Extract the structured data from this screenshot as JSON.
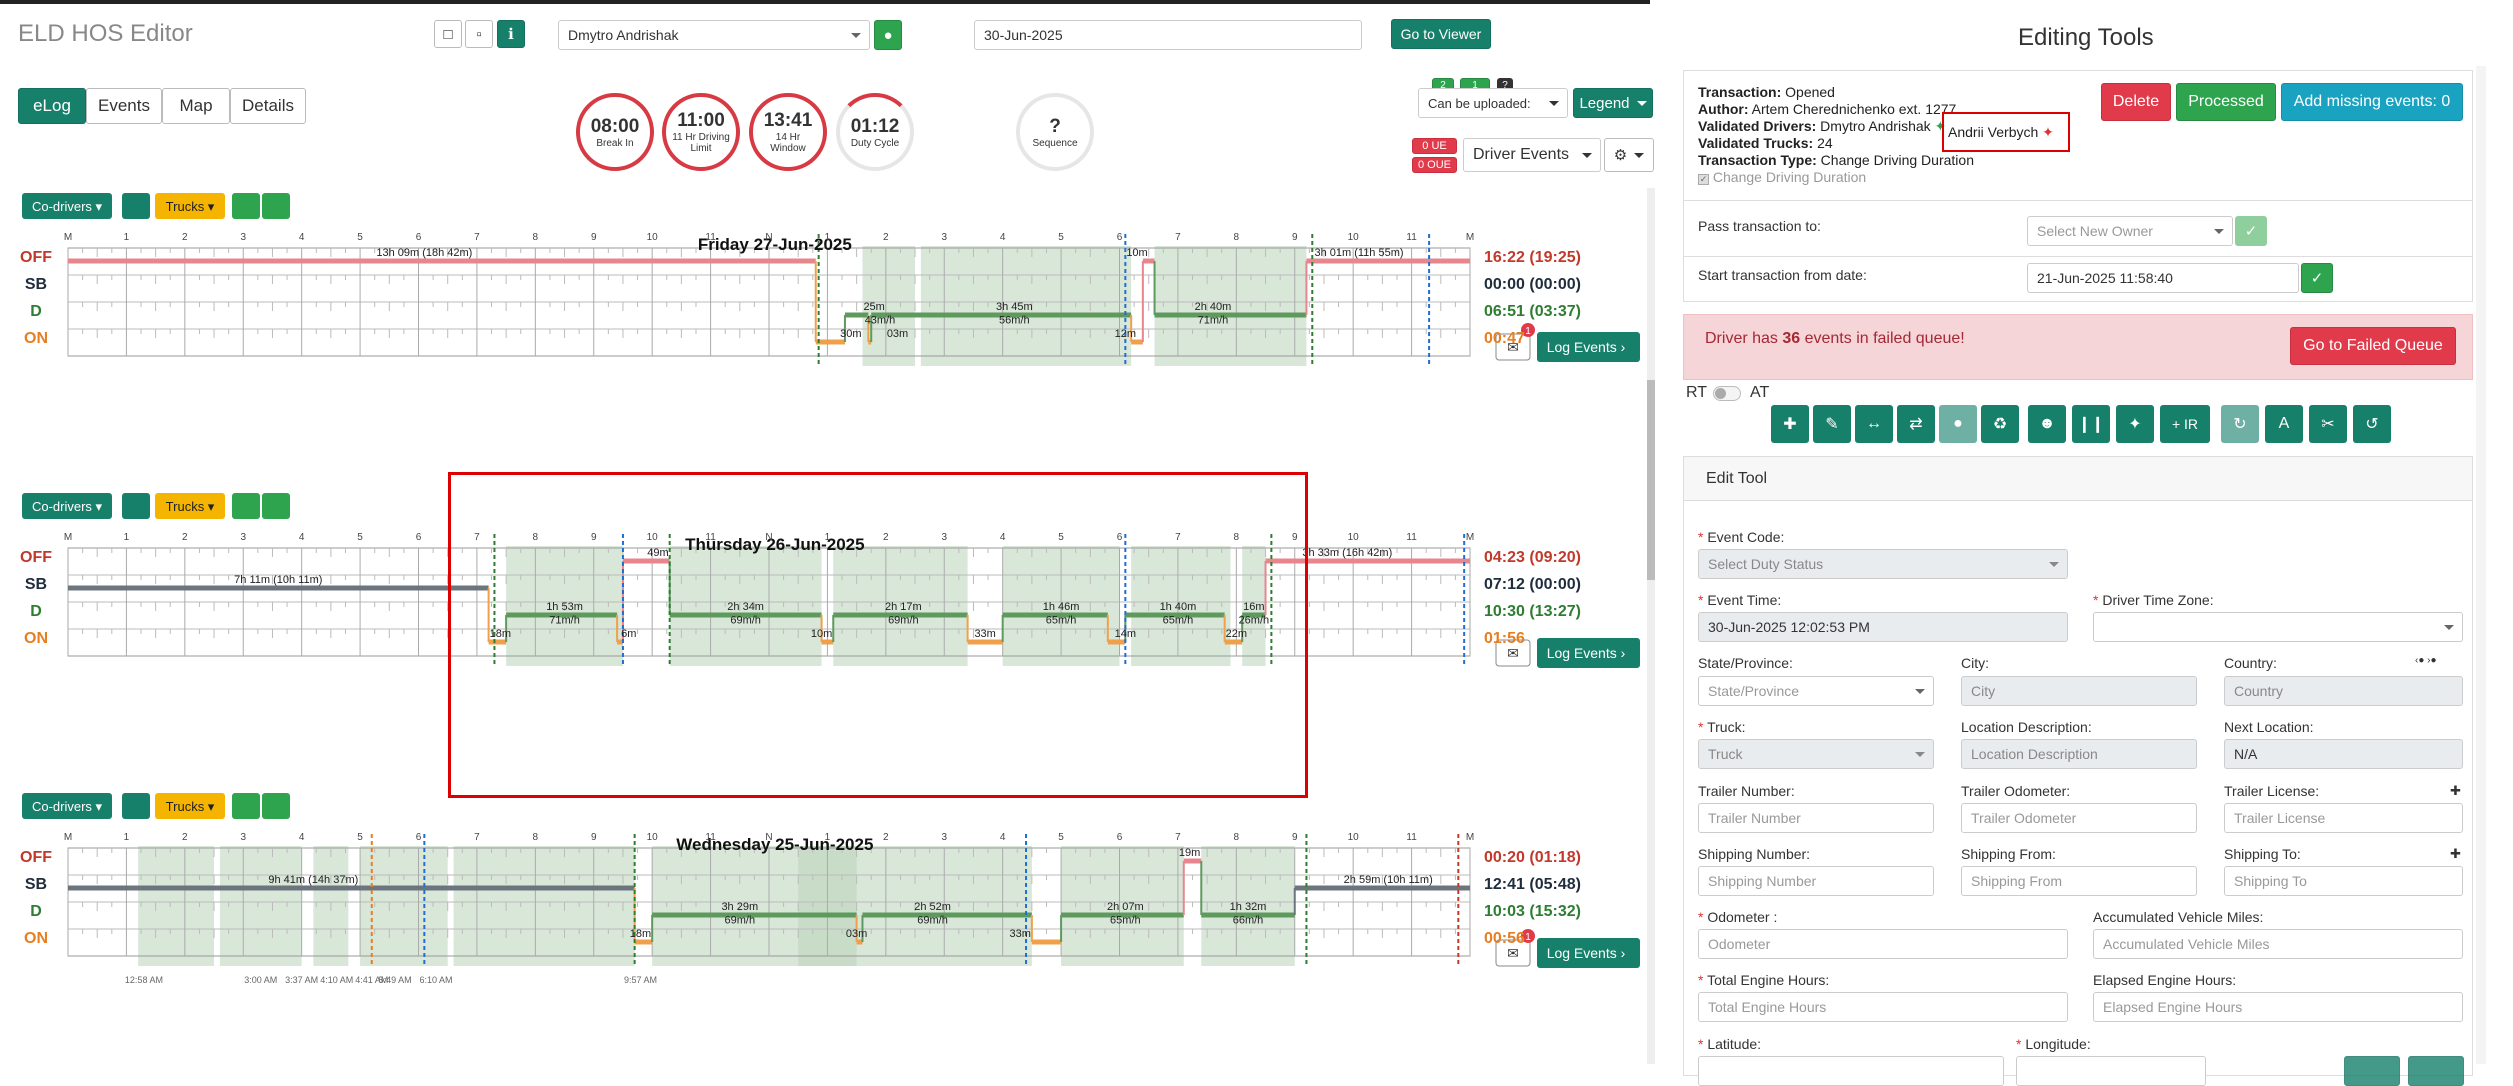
{
  "app_title": "ELD HOS Editor",
  "header": {
    "driver_select": "Dmytro Andrishak",
    "date_input": "30-Jun-2025",
    "go_to_viewer": "Go to Viewer"
  },
  "tabs": [
    "eLog",
    "Events",
    "Map",
    "Details"
  ],
  "gauges": [
    {
      "value": "08:00",
      "label": "Break In"
    },
    {
      "value": "11:00",
      "label": "11 Hr Driving Limit"
    },
    {
      "value": "13:41",
      "label": "14 Hr Window"
    },
    {
      "value": "01:12",
      "label": "Duty Cycle"
    },
    {
      "value": "?",
      "label": "Sequence"
    }
  ],
  "upload": {
    "badge1": "2",
    "badge2": "1",
    "badge3": "?",
    "select": "Can be uploaded:",
    "legend": "Legend",
    "ue": "0 UE",
    "oue": "0 OUE",
    "driver_events": "Driver Events"
  },
  "chart_controls": {
    "codrivers": "Co-drivers",
    "trucks": "Trucks",
    "log_events": "Log Events",
    "comment_count": "1"
  },
  "axis_hours": [
    "M",
    "1",
    "2",
    "3",
    "4",
    "5",
    "6",
    "7",
    "8",
    "9",
    "10",
    "11",
    "N",
    "1",
    "2",
    "3",
    "4",
    "5",
    "6",
    "7",
    "8",
    "9",
    "10",
    "11",
    "M"
  ],
  "row_labels": [
    "OFF",
    "SB",
    "D",
    "ON"
  ],
  "colors": {
    "off": "#c0392b",
    "sb": "#1f2d3d",
    "d": "#2e7d32",
    "on": "#e67e22",
    "teal": "#17806b",
    "shade": "#b9d3b9"
  },
  "days": [
    {
      "title": "Friday 27-Jun-2025",
      "totals": {
        "off": "16:22 (19:25)",
        "sb": "00:00 (00:00)",
        "d": "06:51 (03:37)",
        "on": "00:47"
      },
      "labels": [
        {
          "t": "13h 09m (18h 42m)"
        },
        {
          "t": "10m"
        },
        {
          "t": "3h 01m (11h 55m)"
        },
        {
          "t": "25m"
        },
        {
          "t": "43m/h"
        },
        {
          "t": "3h 45m"
        },
        {
          "t": "56m/h"
        },
        {
          "t": "2h 40m"
        },
        {
          "t": "71m/h"
        },
        {
          "t": "30m"
        },
        {
          "t": "03m"
        },
        {
          "t": "12m"
        }
      ]
    },
    {
      "title": "Thursday 26-Jun-2025",
      "totals": {
        "off": "04:23 (09:20)",
        "sb": "07:12 (00:00)",
        "d": "10:30 (13:27)",
        "on": "01:56"
      },
      "labels": [
        {
          "t": "49m"
        },
        {
          "t": "3h 33m (16h 42m)"
        },
        {
          "t": "7h 11m (10h 11m)"
        },
        {
          "t": "1h 53m"
        },
        {
          "t": "71m/h"
        },
        {
          "t": "2h 34m"
        },
        {
          "t": "69m/h"
        },
        {
          "t": "2h 17m"
        },
        {
          "t": "69m/h"
        },
        {
          "t": "1h 46m"
        },
        {
          "t": "65m/h"
        },
        {
          "t": "1h 40m"
        },
        {
          "t": "65m/h"
        },
        {
          "t": "16m"
        },
        {
          "t": "26m/h"
        },
        {
          "t": "18m"
        },
        {
          "t": "6m"
        },
        {
          "t": "10m"
        },
        {
          "t": "33m"
        },
        {
          "t": "14m"
        },
        {
          "t": "22m"
        }
      ]
    },
    {
      "title": "Wednesday 25-Jun-2025",
      "totals": {
        "off": "00:20 (01:18)",
        "sb": "12:41 (05:48)",
        "d": "10:03 (15:32)",
        "on": "00:56"
      },
      "labels": [
        {
          "t": "19m"
        },
        {
          "t": "9h 41m (14h 37m)"
        },
        {
          "t": "2h 59m (10h 11m)"
        },
        {
          "t": "3h 29m"
        },
        {
          "t": "69m/h"
        },
        {
          "t": "2h 52m"
        },
        {
          "t": "69m/h"
        },
        {
          "t": "2h 07m"
        },
        {
          "t": "65m/h"
        },
        {
          "t": "1h 32m"
        },
        {
          "t": "66m/h"
        },
        {
          "t": "18m"
        },
        {
          "t": "03m"
        },
        {
          "t": "33m"
        }
      ],
      "bottom_times": [
        "12:58 AM",
        "3:00 AM",
        "3:37 AM",
        "4:10 AM",
        "4:41 AM",
        "5:49 AM",
        "6:10 AM",
        "9:57 AM"
      ]
    }
  ],
  "editing": {
    "title": "Editing Tools",
    "transaction": "Opened",
    "author": "Artem Cherednichenko ext. 1277",
    "validated_drivers_a": "Dmytro Andrishak",
    "validated_drivers_b": "Andrii Verbych",
    "validated_trucks": "24",
    "transaction_type": "Change Driving Duration",
    "checkbox": "Change Driving Duration",
    "k_transaction": "Transaction:",
    "k_author": "Author:",
    "k_drivers": "Validated Drivers:",
    "k_trucks": "Validated Trucks:",
    "k_type": "Transaction Type:",
    "delete": "Delete",
    "processed": "Processed",
    "add_missing": "Add missing events: 0",
    "pass_to": "Pass transaction to:",
    "select_owner": "Select New Owner",
    "start_from": "Start transaction from date:",
    "start_date": "21-Jun-2025 11:58:40",
    "failed_a": "Driver has ",
    "failed_n": "36",
    "failed_b": " events in failed queue!",
    "go_failed": "Go to Failed Queue",
    "rt": "RT",
    "at": "AT",
    "ir": "+ IR"
  },
  "edit_tool": {
    "title": "Edit Tool",
    "event_code": "Event Code:",
    "event_code_ph": "Select Duty Status",
    "event_time": "Event Time:",
    "event_time_val": "30-Jun-2025 12:02:53 PM",
    "tz": "Driver Time Zone:",
    "state": "State/Province:",
    "state_ph": "State/Province",
    "city": "City:",
    "city_ph": "City",
    "country": "Country:",
    "country_ph": "Country",
    "truck": "Truck:",
    "truck_ph": "Truck",
    "locdesc": "Location Description:",
    "locdesc_ph": "Location Description",
    "nextloc": "Next Location:",
    "nextloc_val": "N/A",
    "trailer_num": "Trailer Number:",
    "trailer_num_ph": "Trailer Number",
    "trailer_odo": "Trailer Odometer:",
    "trailer_odo_ph": "Trailer Odometer",
    "trailer_lic": "Trailer License:",
    "trailer_lic_ph": "Trailer License",
    "ship_num": "Shipping Number:",
    "ship_num_ph": "Shipping Number",
    "ship_from": "Shipping From:",
    "ship_from_ph": "Shipping From",
    "ship_to": "Shipping To:",
    "ship_to_ph": "Shipping To",
    "odometer": "Odometer :",
    "odometer_ph": "Odometer",
    "acc_miles": "Accumulated Vehicle Miles:",
    "acc_miles_ph": "Accumulated Vehicle Miles",
    "eng_hours": "Total Engine Hours:",
    "eng_hours_ph": "Total Engine Hours",
    "el_hours": "Elapsed Engine Hours:",
    "el_hours_ph": "Elapsed Engine Hours",
    "lat": "Latitude:",
    "lon": "Longitude:"
  }
}
